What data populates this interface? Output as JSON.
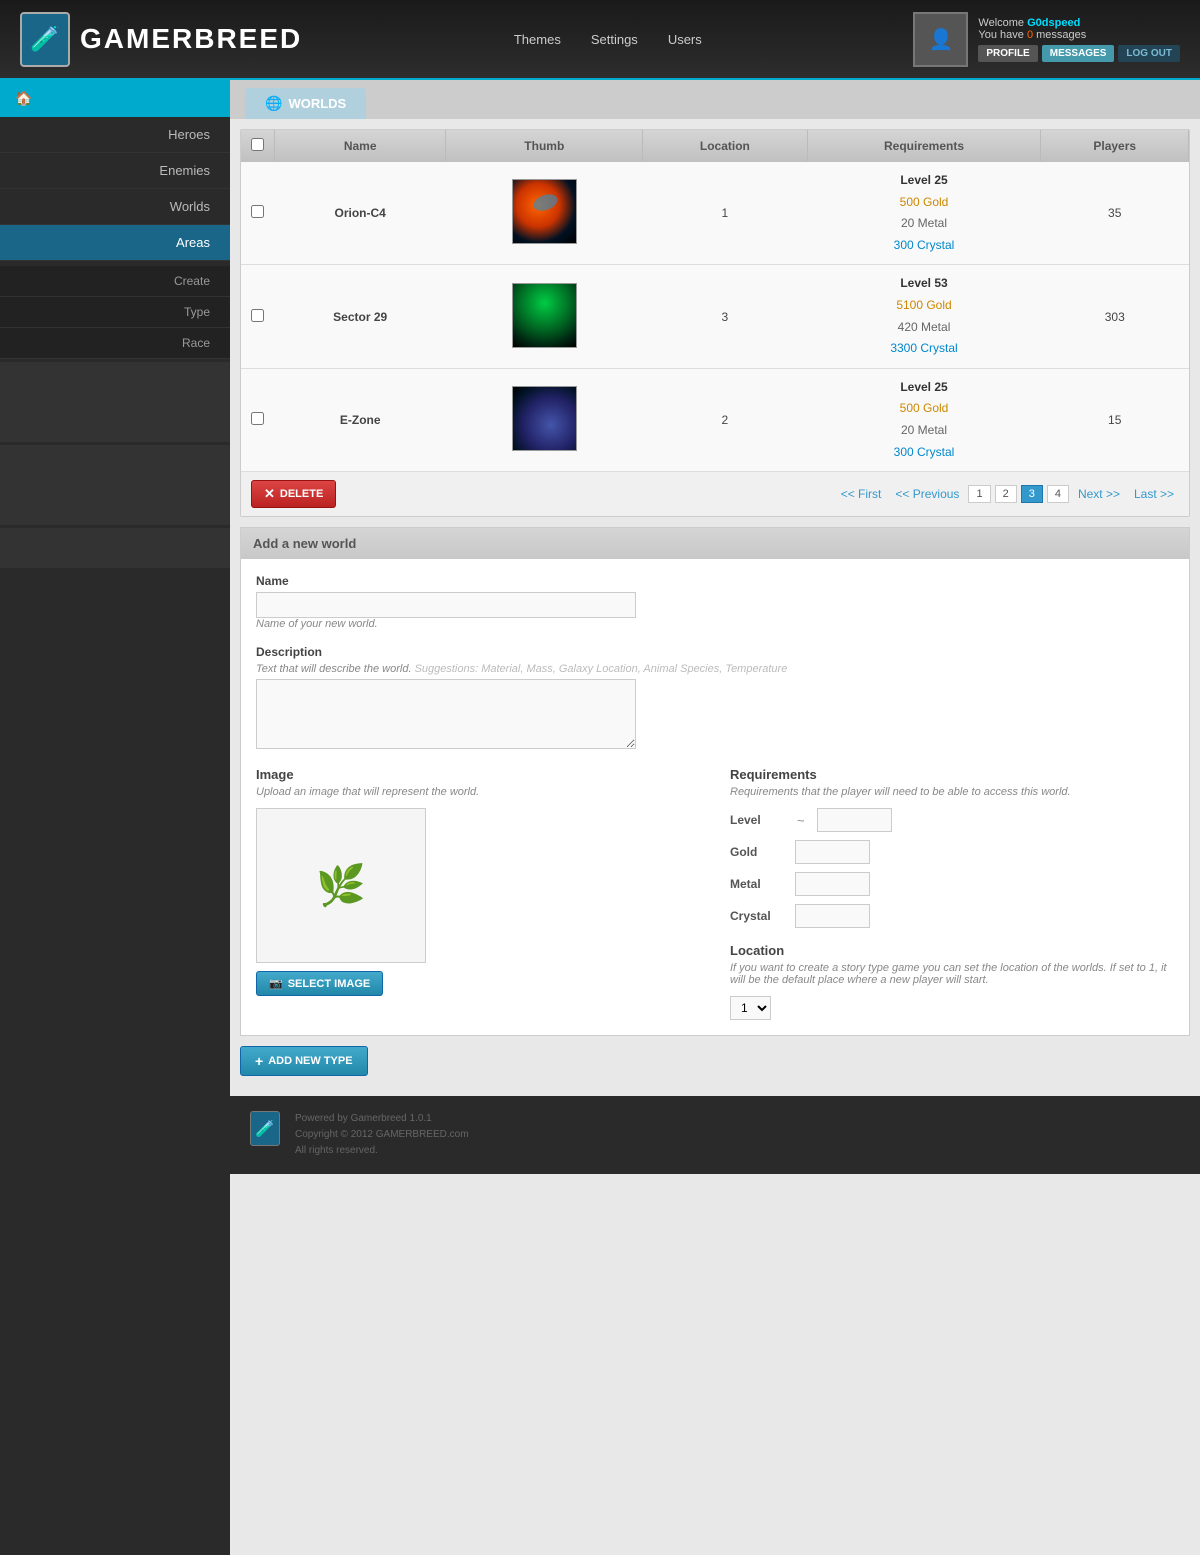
{
  "header": {
    "logo_text": "GAMERBREED",
    "logo_icon": "🧪",
    "nav": {
      "themes": "Themes",
      "settings": "Settings",
      "users": "Users"
    },
    "user": {
      "welcome": "Welcome",
      "username": "G0dspeed",
      "messages_prefix": "You have",
      "messages_count": "0",
      "messages_suffix": "messages",
      "avatar_icon": "👤",
      "btn_profile": "PROFILE",
      "btn_messages": "MESSAGES",
      "btn_logout": "LOG OUT"
    }
  },
  "sidebar": {
    "home_icon": "🏠",
    "items": [
      {
        "label": "Heroes",
        "id": "heroes",
        "active": false
      },
      {
        "label": "Enemies",
        "id": "enemies",
        "active": false
      },
      {
        "label": "Worlds",
        "id": "worlds",
        "active": false
      },
      {
        "label": "Areas",
        "id": "areas",
        "active": true
      }
    ],
    "sub_items": [
      {
        "label": "Create",
        "id": "create"
      },
      {
        "label": "Type",
        "id": "type"
      },
      {
        "label": "Race",
        "id": "race"
      }
    ]
  },
  "tab": {
    "icon": "🌐",
    "label": "WORLDS"
  },
  "table": {
    "columns": [
      "",
      "Name",
      "Thumb",
      "Location",
      "Requirements",
      "Players"
    ],
    "rows": [
      {
        "name": "Orion-C4",
        "location": "1",
        "req_level": "Level 25",
        "req_gold": "500 Gold",
        "req_metal": "20 Metal",
        "req_crystal": "300 Crystal",
        "players": "35",
        "thumb_class": "thumb-planet-1"
      },
      {
        "name": "Sector 29",
        "location": "3",
        "req_level": "Level 53",
        "req_gold": "5100 Gold",
        "req_metal": "420 Metal",
        "req_crystal": "3300 Crystal",
        "players": "303",
        "thumb_class": "thumb-planet-2"
      },
      {
        "name": "E-Zone",
        "location": "2",
        "req_level": "Level 25",
        "req_gold": "500 Gold",
        "req_metal": "20 Metal",
        "req_crystal": "300 Crystal",
        "players": "15",
        "thumb_class": "thumb-planet-3"
      }
    ]
  },
  "pagination": {
    "first": "<< First",
    "previous": "<< Previous",
    "pages": [
      "1",
      "2",
      "3",
      "4"
    ],
    "active_page": "3",
    "next": "Next >>",
    "last": "Last >>"
  },
  "delete_btn": "DELETE",
  "add_world_form": {
    "header": "Add a new world",
    "name_label": "Name",
    "name_placeholder": "",
    "name_hint": "Name of your new world.",
    "desc_label": "Description",
    "desc_hint": "Text that will describe the world.",
    "desc_placeholder": "Suggestions: Material, Mass, Galaxy Location, Animal Species, Temperature",
    "image_label": "Image",
    "image_hint": "Upload an image that will represent the world.",
    "image_icon": "🌿",
    "select_image_btn": "SELECT IMAGE",
    "requirements_label": "Requirements",
    "requirements_hint": "Requirements that the player will need to be able to access this world.",
    "level_label": "Level",
    "level_tilde": "~",
    "gold_label": "Gold",
    "metal_label": "Metal",
    "crystal_label": "Crystal",
    "location_label": "Location",
    "location_hint": "If you want to create a story type game you can set the location of the worlds. If set to 1, it will be the default place where a new player will start.",
    "location_value": "1"
  },
  "add_type_btn": "ADD NEW TYPE",
  "footer": {
    "logo_icon": "🧪",
    "powered_by": "Powered by Gamerbreed 1.0.1",
    "copyright": "Copyright © 2012 GAMERBREED.com",
    "rights": "All rights reserved."
  }
}
